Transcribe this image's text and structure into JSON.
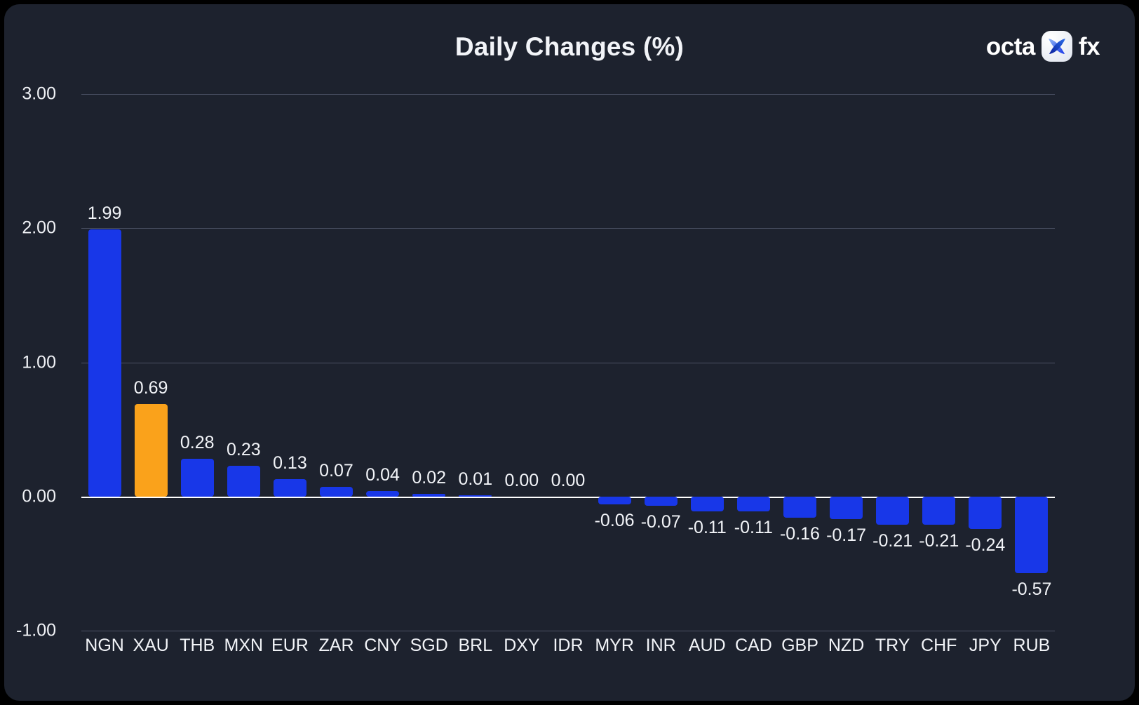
{
  "header": {
    "title": "Daily Changes (%)",
    "brand_left": "octa",
    "brand_right": "fx",
    "logo_icon": "octa-x-logo-icon"
  },
  "theme": {
    "background": "#1d222e",
    "page_background": "#000000",
    "bar_color": "#1837e8",
    "highlight_bar_color": "#faa21b",
    "text_color": "#f2f4f8",
    "gridline_color": "#4b5164",
    "zero_line_color": "#ffffff"
  },
  "chart_data": {
    "type": "bar",
    "title": "Daily Changes (%)",
    "xlabel": "",
    "ylabel": "",
    "ylim": [
      -1.0,
      3.0
    ],
    "yticks": [
      3.0,
      2.0,
      1.0,
      0.0,
      -1.0
    ],
    "ytick_labels": [
      "3.00",
      "2.00",
      "1.00",
      "0.00",
      "-1.00"
    ],
    "grid": true,
    "legend": null,
    "highlight_category": "XAU",
    "categories": [
      "NGN",
      "XAU",
      "THB",
      "MXN",
      "EUR",
      "ZAR",
      "CNY",
      "SGD",
      "BRL",
      "DXY",
      "IDR",
      "MYR",
      "INR",
      "AUD",
      "CAD",
      "GBP",
      "NZD",
      "TRY",
      "CHF",
      "JPY",
      "RUB"
    ],
    "values": [
      1.99,
      0.69,
      0.28,
      0.23,
      0.13,
      0.07,
      0.04,
      0.02,
      0.01,
      0.0,
      0.0,
      -0.06,
      -0.07,
      -0.11,
      -0.11,
      -0.16,
      -0.17,
      -0.21,
      -0.21,
      -0.24,
      -0.57
    ],
    "value_labels": [
      "1.99",
      "0.69",
      "0.28",
      "0.23",
      "0.13",
      "0.07",
      "0.04",
      "0.02",
      "0.01",
      "0.00",
      "0.00",
      "-0.06",
      "-0.07",
      "-0.11",
      "-0.11",
      "-0.16",
      "-0.17",
      "-0.21",
      "-0.21",
      "-0.24",
      "-0.57"
    ]
  }
}
